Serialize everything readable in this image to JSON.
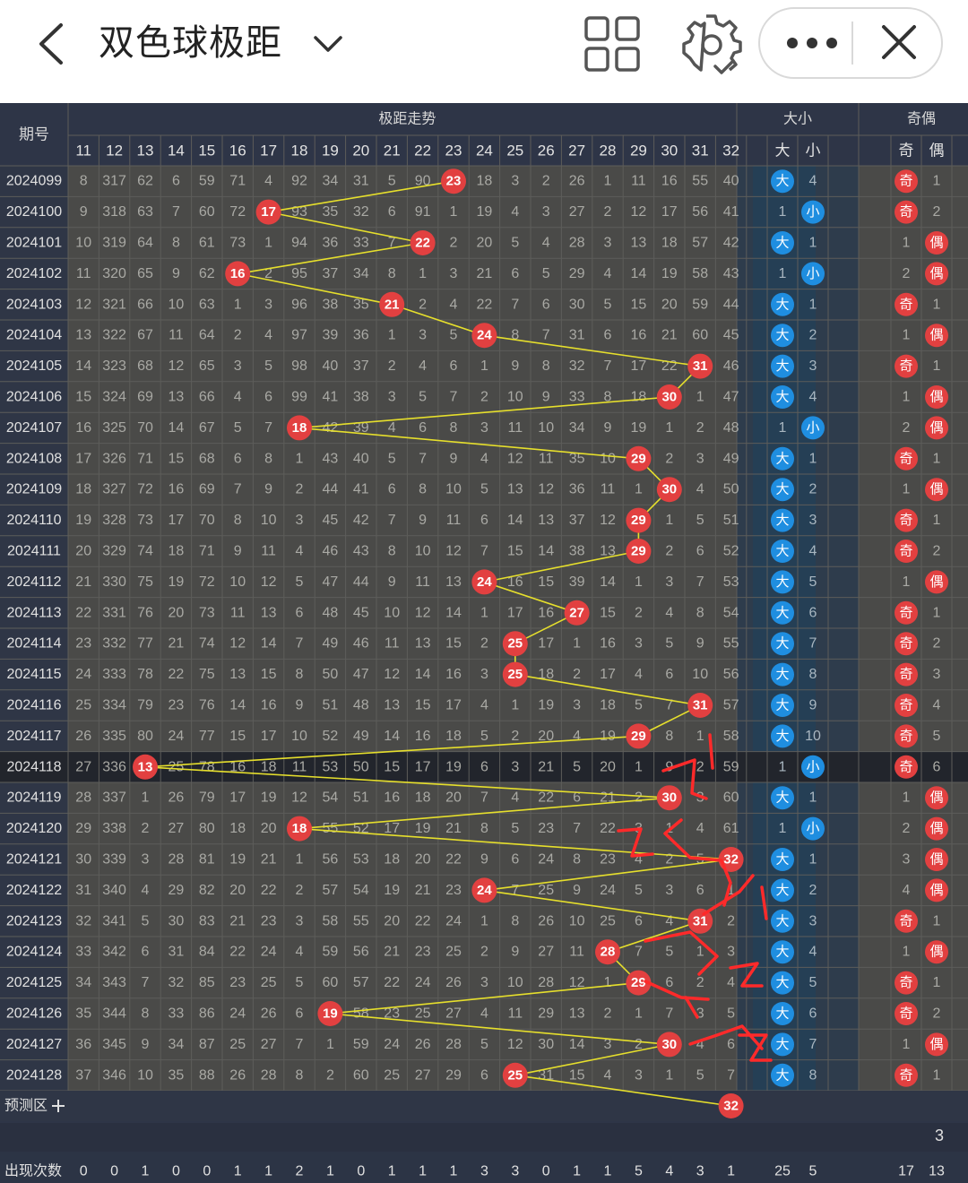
{
  "header": {
    "title": "双色球极距",
    "back_icon": "chevron-left-icon",
    "title_menu_icon": "chevron-down-icon",
    "grid_icon": "grid-view-icon",
    "settings_icon": "gear-icon",
    "more_icon": "more-dots-icon",
    "close_icon": "close-icon"
  },
  "table": {
    "period_header": "期号",
    "trend_header": "极距走势",
    "size_header": "大小",
    "parity_header": "奇偶",
    "size_sub": [
      "大",
      "小"
    ],
    "parity_sub": [
      "奇",
      "偶"
    ],
    "columns": [
      "11",
      "12",
      "13",
      "14",
      "15",
      "16",
      "17",
      "18",
      "19",
      "20",
      "21",
      "22",
      "23",
      "24",
      "25",
      "26",
      "27",
      "28",
      "29",
      "30",
      "31",
      "32"
    ],
    "highlighted_row": "2024118",
    "rows": [
      {
        "period": "2024099",
        "cells": [
          "8",
          "317",
          "62",
          "6",
          "59",
          "71",
          "4",
          "92",
          "34",
          "31",
          "5",
          "90",
          "23",
          "18",
          "3",
          "2",
          "26",
          "1",
          "11",
          "16",
          "55",
          "40"
        ],
        "hit": 23,
        "size": "大",
        "size_miss": "4",
        "parity": "奇",
        "parity_miss": "1"
      },
      {
        "period": "2024100",
        "cells": [
          "9",
          "318",
          "63",
          "7",
          "60",
          "72",
          "17",
          "93",
          "35",
          "32",
          "6",
          "91",
          "1",
          "19",
          "4",
          "3",
          "27",
          "2",
          "12",
          "17",
          "56",
          "41"
        ],
        "hit": 17,
        "size": "小",
        "size_miss": "1",
        "parity": "奇",
        "parity_miss": "2"
      },
      {
        "period": "2024101",
        "cells": [
          "10",
          "319",
          "64",
          "8",
          "61",
          "73",
          "1",
          "94",
          "36",
          "33",
          "7",
          "22",
          "2",
          "20",
          "5",
          "4",
          "28",
          "3",
          "13",
          "18",
          "57",
          "42"
        ],
        "hit": 22,
        "size": "大",
        "size_miss": "1",
        "parity": "偶",
        "parity_miss": "1"
      },
      {
        "period": "2024102",
        "cells": [
          "11",
          "320",
          "65",
          "9",
          "62",
          "16",
          "2",
          "95",
          "37",
          "34",
          "8",
          "1",
          "3",
          "21",
          "6",
          "5",
          "29",
          "4",
          "14",
          "19",
          "58",
          "43"
        ],
        "hit": 16,
        "size": "小",
        "size_miss": "1",
        "parity": "偶",
        "parity_miss": "2"
      },
      {
        "period": "2024103",
        "cells": [
          "12",
          "321",
          "66",
          "10",
          "63",
          "1",
          "3",
          "96",
          "38",
          "35",
          "21",
          "2",
          "4",
          "22",
          "7",
          "6",
          "30",
          "5",
          "15",
          "20",
          "59",
          "44"
        ],
        "hit": 21,
        "size": "大",
        "size_miss": "1",
        "parity": "奇",
        "parity_miss": "1"
      },
      {
        "period": "2024104",
        "cells": [
          "13",
          "322",
          "67",
          "11",
          "64",
          "2",
          "4",
          "97",
          "39",
          "36",
          "1",
          "3",
          "5",
          "24",
          "8",
          "7",
          "31",
          "6",
          "16",
          "21",
          "60",
          "45"
        ],
        "hit": 24,
        "size": "大",
        "size_miss": "2",
        "parity": "偶",
        "parity_miss": "1"
      },
      {
        "period": "2024105",
        "cells": [
          "14",
          "323",
          "68",
          "12",
          "65",
          "3",
          "5",
          "98",
          "40",
          "37",
          "2",
          "4",
          "6",
          "1",
          "9",
          "8",
          "32",
          "7",
          "17",
          "22",
          "31",
          "46"
        ],
        "hit": 31,
        "size": "大",
        "size_miss": "3",
        "parity": "奇",
        "parity_miss": "1"
      },
      {
        "period": "2024106",
        "cells": [
          "15",
          "324",
          "69",
          "13",
          "66",
          "4",
          "6",
          "99",
          "41",
          "38",
          "3",
          "5",
          "7",
          "2",
          "10",
          "9",
          "33",
          "8",
          "18",
          "30",
          "1",
          "47"
        ],
        "hit": 30,
        "size": "大",
        "size_miss": "4",
        "parity": "偶",
        "parity_miss": "1"
      },
      {
        "period": "2024107",
        "cells": [
          "16",
          "325",
          "70",
          "14",
          "67",
          "5",
          "7",
          "18",
          "42",
          "39",
          "4",
          "6",
          "8",
          "3",
          "11",
          "10",
          "34",
          "9",
          "19",
          "1",
          "2",
          "48"
        ],
        "hit": 18,
        "size": "小",
        "size_miss": "1",
        "parity": "偶",
        "parity_miss": "2"
      },
      {
        "period": "2024108",
        "cells": [
          "17",
          "326",
          "71",
          "15",
          "68",
          "6",
          "8",
          "1",
          "43",
          "40",
          "5",
          "7",
          "9",
          "4",
          "12",
          "11",
          "35",
          "10",
          "29",
          "2",
          "3",
          "49"
        ],
        "hit": 29,
        "size": "大",
        "size_miss": "1",
        "parity": "奇",
        "parity_miss": "1"
      },
      {
        "period": "2024109",
        "cells": [
          "18",
          "327",
          "72",
          "16",
          "69",
          "7",
          "9",
          "2",
          "44",
          "41",
          "6",
          "8",
          "10",
          "5",
          "13",
          "12",
          "36",
          "11",
          "1",
          "30",
          "4",
          "50"
        ],
        "hit": 30,
        "size": "大",
        "size_miss": "2",
        "parity": "偶",
        "parity_miss": "1"
      },
      {
        "period": "2024110",
        "cells": [
          "19",
          "328",
          "73",
          "17",
          "70",
          "8",
          "10",
          "3",
          "45",
          "42",
          "7",
          "9",
          "11",
          "6",
          "14",
          "13",
          "37",
          "12",
          "29",
          "1",
          "5",
          "51"
        ],
        "hit": 29,
        "size": "大",
        "size_miss": "3",
        "parity": "奇",
        "parity_miss": "1"
      },
      {
        "period": "2024111",
        "cells": [
          "20",
          "329",
          "74",
          "18",
          "71",
          "9",
          "11",
          "4",
          "46",
          "43",
          "8",
          "10",
          "12",
          "7",
          "15",
          "14",
          "38",
          "13",
          "29",
          "2",
          "6",
          "52"
        ],
        "hit": 29,
        "size": "大",
        "size_miss": "4",
        "parity": "奇",
        "parity_miss": "2"
      },
      {
        "period": "2024112",
        "cells": [
          "21",
          "330",
          "75",
          "19",
          "72",
          "10",
          "12",
          "5",
          "47",
          "44",
          "9",
          "11",
          "13",
          "24",
          "16",
          "15",
          "39",
          "14",
          "1",
          "3",
          "7",
          "53"
        ],
        "hit": 24,
        "size": "大",
        "size_miss": "5",
        "parity": "偶",
        "parity_miss": "1"
      },
      {
        "period": "2024113",
        "cells": [
          "22",
          "331",
          "76",
          "20",
          "73",
          "11",
          "13",
          "6",
          "48",
          "45",
          "10",
          "12",
          "14",
          "1",
          "17",
          "16",
          "27",
          "15",
          "2",
          "4",
          "8",
          "54"
        ],
        "hit": 27,
        "size": "大",
        "size_miss": "6",
        "parity": "奇",
        "parity_miss": "1"
      },
      {
        "period": "2024114",
        "cells": [
          "23",
          "332",
          "77",
          "21",
          "74",
          "12",
          "14",
          "7",
          "49",
          "46",
          "11",
          "13",
          "15",
          "2",
          "25",
          "17",
          "1",
          "16",
          "3",
          "5",
          "9",
          "55"
        ],
        "hit": 25,
        "size": "大",
        "size_miss": "7",
        "parity": "奇",
        "parity_miss": "2"
      },
      {
        "period": "2024115",
        "cells": [
          "24",
          "333",
          "78",
          "22",
          "75",
          "13",
          "15",
          "8",
          "50",
          "47",
          "12",
          "14",
          "16",
          "3",
          "25",
          "18",
          "2",
          "17",
          "4",
          "6",
          "10",
          "56"
        ],
        "hit": 25,
        "size": "大",
        "size_miss": "8",
        "parity": "奇",
        "parity_miss": "3"
      },
      {
        "period": "2024116",
        "cells": [
          "25",
          "334",
          "79",
          "23",
          "76",
          "14",
          "16",
          "9",
          "51",
          "48",
          "13",
          "15",
          "17",
          "4",
          "1",
          "19",
          "3",
          "18",
          "5",
          "7",
          "31",
          "57"
        ],
        "hit": 31,
        "size": "大",
        "size_miss": "9",
        "parity": "奇",
        "parity_miss": "4"
      },
      {
        "period": "2024117",
        "cells": [
          "26",
          "335",
          "80",
          "24",
          "77",
          "15",
          "17",
          "10",
          "52",
          "49",
          "14",
          "16",
          "18",
          "5",
          "2",
          "20",
          "4",
          "19",
          "29",
          "8",
          "1",
          "58"
        ],
        "hit": 29,
        "size": "大",
        "size_miss": "10",
        "parity": "奇",
        "parity_miss": "5"
      },
      {
        "period": "2024118",
        "cells": [
          "27",
          "336",
          "13",
          "25",
          "78",
          "16",
          "18",
          "11",
          "53",
          "50",
          "15",
          "17",
          "19",
          "6",
          "3",
          "21",
          "5",
          "20",
          "1",
          "9",
          "2",
          "59"
        ],
        "hit": 13,
        "size": "小",
        "size_miss": "1",
        "parity": "奇",
        "parity_miss": "6"
      },
      {
        "period": "2024119",
        "cells": [
          "28",
          "337",
          "1",
          "26",
          "79",
          "17",
          "19",
          "12",
          "54",
          "51",
          "16",
          "18",
          "20",
          "7",
          "4",
          "22",
          "6",
          "21",
          "2",
          "30",
          "3",
          "60"
        ],
        "hit": 30,
        "size": "大",
        "size_miss": "1",
        "parity": "偶",
        "parity_miss": "1"
      },
      {
        "period": "2024120",
        "cells": [
          "29",
          "338",
          "2",
          "27",
          "80",
          "18",
          "20",
          "18",
          "55",
          "52",
          "17",
          "19",
          "21",
          "8",
          "5",
          "23",
          "7",
          "22",
          "3",
          "1",
          "4",
          "61"
        ],
        "hit": 18,
        "size": "小",
        "size_miss": "1",
        "parity": "偶",
        "parity_miss": "2"
      },
      {
        "period": "2024121",
        "cells": [
          "30",
          "339",
          "3",
          "28",
          "81",
          "19",
          "21",
          "1",
          "56",
          "53",
          "18",
          "20",
          "22",
          "9",
          "6",
          "24",
          "8",
          "23",
          "4",
          "2",
          "5",
          "32"
        ],
        "hit": 32,
        "size": "大",
        "size_miss": "1",
        "parity": "偶",
        "parity_miss": "3"
      },
      {
        "period": "2024122",
        "cells": [
          "31",
          "340",
          "4",
          "29",
          "82",
          "20",
          "22",
          "2",
          "57",
          "54",
          "19",
          "21",
          "23",
          "24",
          "7",
          "25",
          "9",
          "24",
          "5",
          "3",
          "6",
          "1"
        ],
        "hit": 24,
        "size": "大",
        "size_miss": "2",
        "parity": "偶",
        "parity_miss": "4"
      },
      {
        "period": "2024123",
        "cells": [
          "32",
          "341",
          "5",
          "30",
          "83",
          "21",
          "23",
          "3",
          "58",
          "55",
          "20",
          "22",
          "24",
          "1",
          "8",
          "26",
          "10",
          "25",
          "6",
          "4",
          "31",
          "2"
        ],
        "hit": 31,
        "size": "大",
        "size_miss": "3",
        "parity": "奇",
        "parity_miss": "1"
      },
      {
        "period": "2024124",
        "cells": [
          "33",
          "342",
          "6",
          "31",
          "84",
          "22",
          "24",
          "4",
          "59",
          "56",
          "21",
          "23",
          "25",
          "2",
          "9",
          "27",
          "11",
          "28",
          "7",
          "5",
          "1",
          "3"
        ],
        "hit": 28,
        "size": "大",
        "size_miss": "4",
        "parity": "偶",
        "parity_miss": "1"
      },
      {
        "period": "2024125",
        "cells": [
          "34",
          "343",
          "7",
          "32",
          "85",
          "23",
          "25",
          "5",
          "60",
          "57",
          "22",
          "24",
          "26",
          "3",
          "10",
          "28",
          "12",
          "1",
          "29",
          "6",
          "2",
          "4"
        ],
        "hit": 29,
        "size": "大",
        "size_miss": "5",
        "parity": "奇",
        "parity_miss": "1"
      },
      {
        "period": "2024126",
        "cells": [
          "35",
          "344",
          "8",
          "33",
          "86",
          "24",
          "26",
          "6",
          "19",
          "58",
          "23",
          "25",
          "27",
          "4",
          "11",
          "29",
          "13",
          "2",
          "1",
          "7",
          "3",
          "5"
        ],
        "hit": 19,
        "size": "大",
        "size_miss": "6",
        "parity": "奇",
        "parity_miss": "2"
      },
      {
        "period": "2024127",
        "cells": [
          "36",
          "345",
          "9",
          "34",
          "87",
          "25",
          "27",
          "7",
          "1",
          "59",
          "24",
          "26",
          "28",
          "5",
          "12",
          "30",
          "14",
          "3",
          "2",
          "30",
          "4",
          "6"
        ],
        "hit": 30,
        "size": "大",
        "size_miss": "7",
        "parity": "偶",
        "parity_miss": "1"
      },
      {
        "period": "2024128",
        "cells": [
          "37",
          "346",
          "10",
          "35",
          "88",
          "26",
          "28",
          "8",
          "2",
          "60",
          "25",
          "27",
          "29",
          "6",
          "25",
          "31",
          "15",
          "4",
          "3",
          "1",
          "5",
          "7"
        ],
        "hit": 25,
        "size": "大",
        "size_miss": "8",
        "parity": "奇",
        "parity_miss": "1"
      }
    ],
    "predict_label": "预测区",
    "predict_add_icon": "plus-icon",
    "predict_value": 32,
    "count_label": "出现次数",
    "counts": [
      "0",
      "0",
      "1",
      "0",
      "0",
      "1",
      "1",
      "2",
      "1",
      "0",
      "1",
      "1",
      "1",
      "3",
      "3",
      "0",
      "1",
      "1",
      "5",
      "4",
      "3",
      "1"
    ],
    "size_counts": [
      "25",
      "5"
    ],
    "parity_counts": [
      "17",
      "13"
    ],
    "stray_value": "3",
    "handwritten_annotations": [
      "1",
      "2",
      "1",
      "2",
      "1",
      "2"
    ]
  },
  "colors": {
    "header_bg": "#2e3547",
    "row_bg": "#4a4a48",
    "ball_red": "#e24040",
    "ball_blue": "#1f8ee0",
    "trend_line": "#e6df2c",
    "highlight_row": "#22252c"
  }
}
